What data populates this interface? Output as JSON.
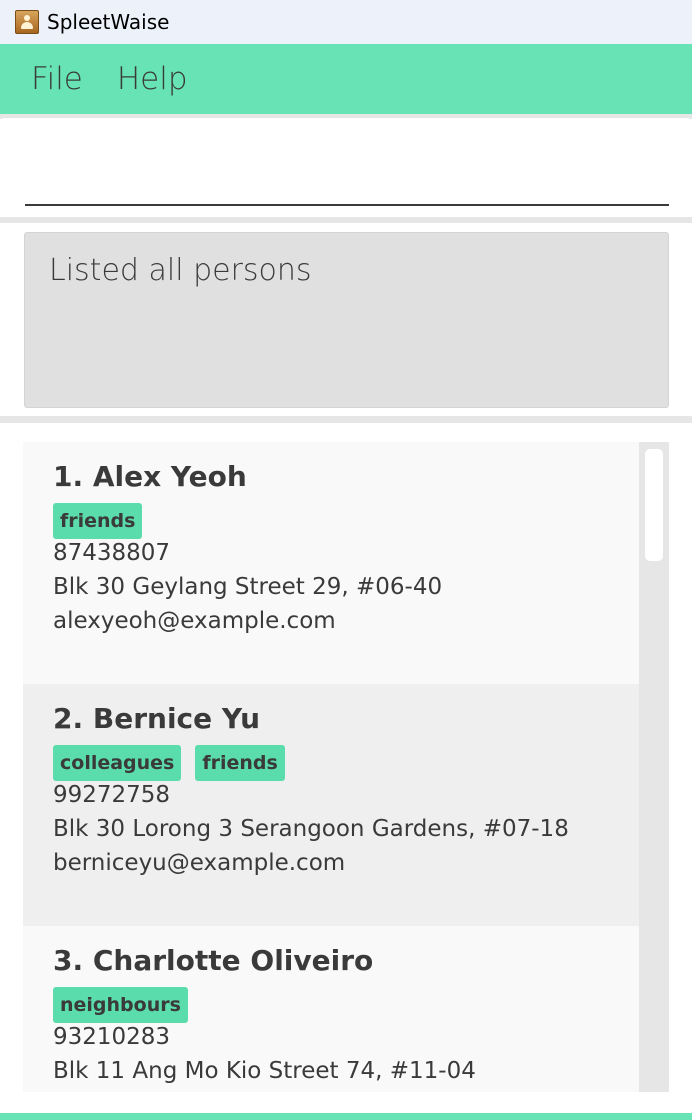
{
  "window": {
    "title": "SpleetWaise",
    "icon": "address-book-icon"
  },
  "menu": {
    "file": "File",
    "help": "Help"
  },
  "command": {
    "value": "",
    "placeholder": ""
  },
  "result": {
    "message": "Listed all persons"
  },
  "persons": [
    {
      "title": "1. Alex Yeoh",
      "tags": [
        "friends"
      ],
      "phone": "87438807",
      "address": "Blk 30 Geylang Street 29, #06-40",
      "email": "alexyeoh@example.com"
    },
    {
      "title": "2. Bernice Yu",
      "tags": [
        "colleagues",
        "friends"
      ],
      "phone": "99272758",
      "address": "Blk 30 Lorong 3 Serangoon Gardens, #07-18",
      "email": "berniceyu@example.com"
    },
    {
      "title": "3. Charlotte Oliveiro",
      "tags": [
        "neighbours"
      ],
      "phone": "93210283",
      "address": "Blk 11 Ang Mo Kio Street 74, #11-04",
      "email": ""
    }
  ],
  "colors": {
    "accent": "#67e3b5",
    "tag": "#5adcac",
    "text": "#3a3a3a"
  }
}
